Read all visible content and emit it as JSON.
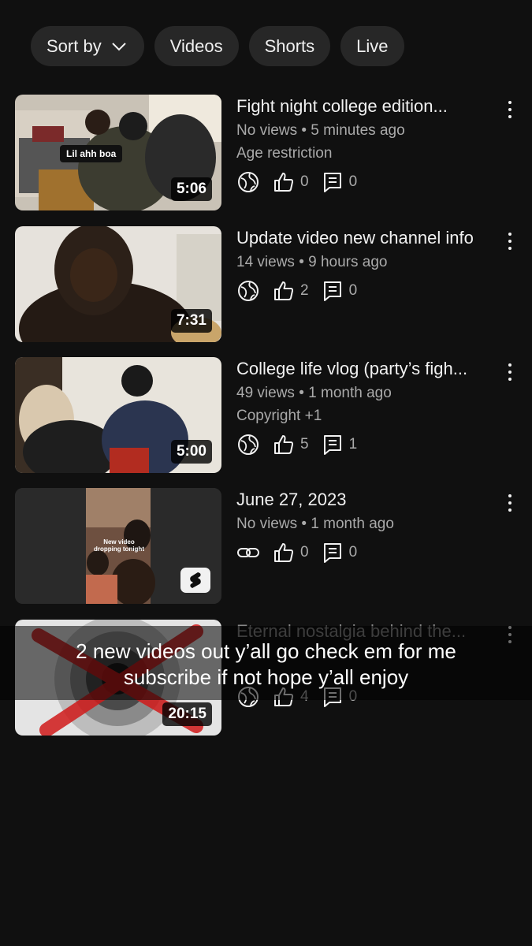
{
  "filters": {
    "sort_label": "Sort by",
    "chips": [
      "Videos",
      "Shorts",
      "Live"
    ]
  },
  "videos": [
    {
      "title": "Fight night college edition...",
      "views": "No views",
      "age": "5 minutes ago",
      "restriction": "Age restriction",
      "duration": "5:06",
      "overlay_text": "Lil ahh boa",
      "visibility_icon": "globe-icon",
      "likes": "0",
      "comments": "0"
    },
    {
      "title": "Update video new channel info",
      "views": "14 views",
      "age": "9 hours ago",
      "duration": "7:31",
      "visibility_icon": "globe-icon",
      "likes": "2",
      "comments": "0"
    },
    {
      "title": "College life vlog (party’s figh...",
      "views": "49 views",
      "age": "1 month ago",
      "restriction": "Copyright +1",
      "duration": "5:00",
      "visibility_icon": "globe-icon",
      "likes": "5",
      "comments": "1"
    },
    {
      "title": "June 27, 2023",
      "views": "No views",
      "age": "1 month ago",
      "overlay_text": "New video dropping tonight",
      "visibility_icon": "link-icon",
      "likes": "0",
      "comments": "0",
      "is_short": true
    },
    {
      "title": "Eternal nostalgia behind the...",
      "duration": "20:15",
      "visibility_icon": "globe-icon",
      "likes": "4",
      "comments": "0"
    }
  ],
  "caption": {
    "line1": "2 new videos out y’all go check em for me",
    "line2": "subscribe if not hope y’all enjoy"
  },
  "separator": "•"
}
